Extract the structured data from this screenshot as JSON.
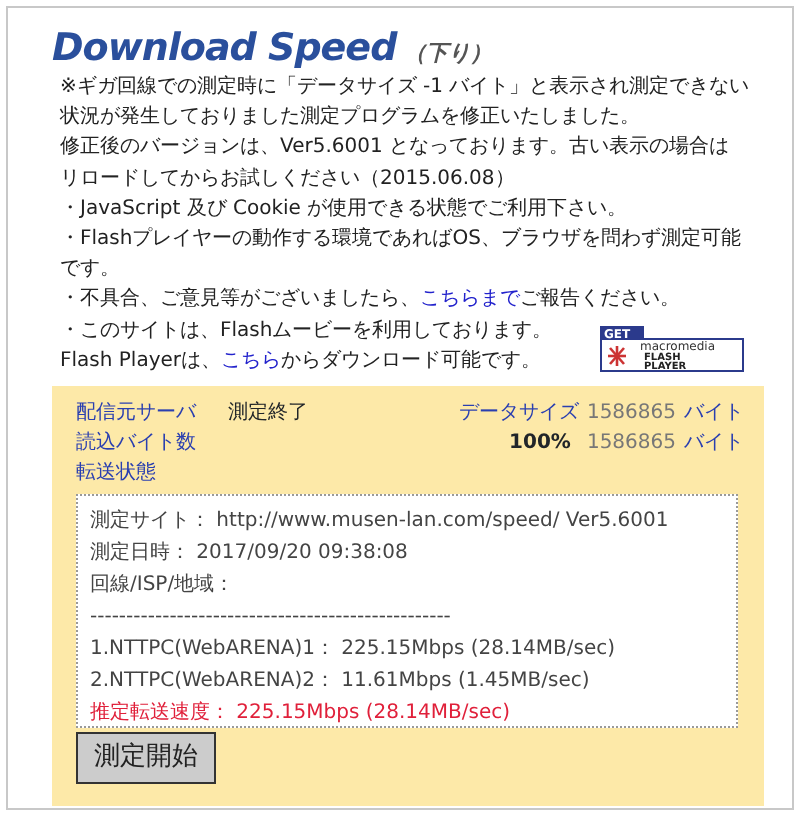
{
  "title": "Download Speed",
  "subtitle": "（下り）",
  "notice_lines": [
    "※ギガ回線での測定時に「データサイズ -1 バイト」と表示され測定できない",
    "状況が発生しておりました測定プログラムを修正いたしました。",
    "修正後のバージョンは、Ver5.6001 となっております。古い表示の場合は",
    "リロードしてからお試しください（2015.06.08）"
  ],
  "bullets": [
    {
      "before": "・JavaScript 及び Cookie が使用できる状態でご利用下さい。"
    },
    {
      "before": "・Flashプレイヤーの動作する環境であればOS、ブラウザを問わず測定可能です。"
    },
    {
      "before": "・不具合、ご意見等がございましたら、",
      "link": "こちらまで",
      "after": "ご報告ください。"
    },
    {
      "before": "・このサイトは、Flashムービーを利用しております。"
    },
    {
      "before": "Flash Playerは、",
      "link": "こちら",
      "after": "からダウンロード可能です。"
    }
  ],
  "flash_badge": {
    "top": "GET",
    "brand": "macromedia",
    "line1": "FLASH",
    "line2": "PLAYER"
  },
  "status": {
    "server_label": "配信元サーバ",
    "state": "測定終了",
    "read_label": "読込バイト数",
    "transfer_label": "転送状態",
    "size_label": "データサイズ",
    "size_value": "1586865",
    "size_unit": "バイト",
    "percent": "100%",
    "read_value": "1586865",
    "read_unit": "バイト"
  },
  "results": [
    {
      "kind": "plain",
      "text": "測定サイト： http://www.musen-lan.com/speed/ Ver5.6001"
    },
    {
      "kind": "plain",
      "text": "測定日時： 2017/09/20 09:38:08"
    },
    {
      "kind": "plain",
      "text": "回線/ISP/地域："
    },
    {
      "kind": "plain",
      "text": "--------------------------------------------------"
    },
    {
      "kind": "plain",
      "text": "1.NTTPC(WebARENA)1： 225.15Mbps (28.14MB/sec)"
    },
    {
      "kind": "plain",
      "text": "2.NTTPC(WebARENA)2： 11.61Mbps (1.45MB/sec)"
    },
    {
      "kind": "estimate",
      "text": "推定転送速度： 225.15Mbps (28.14MB/sec)"
    }
  ],
  "start_button": "測定開始"
}
